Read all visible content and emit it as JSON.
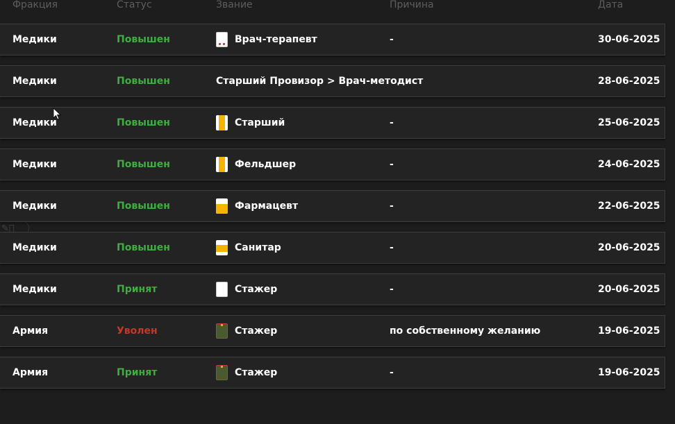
{
  "header": {
    "faction": "Фракция",
    "status": "Статус",
    "rank": "Звание",
    "reason": "Причина",
    "date": "Дата"
  },
  "rows": [
    {
      "faction": "Медики",
      "status": "Повышен",
      "status_color": "green",
      "badge": "white-red",
      "rank": "Врач-терапевт",
      "reason": "-",
      "date": "30-06-2025"
    },
    {
      "faction": "Медики",
      "status": "Повышен",
      "status_color": "green",
      "badge": "none",
      "rank": "Старший Провизор > Врач-методист",
      "reason": "",
      "date": "28-06-2025"
    },
    {
      "faction": "Медики",
      "status": "Повышен",
      "status_color": "green",
      "badge": "yellow-stripe",
      "rank": "Старший",
      "reason": "-",
      "date": "25-06-2025"
    },
    {
      "faction": "Медики",
      "status": "Повышен",
      "status_color": "green",
      "badge": "yellow-stripe",
      "rank": "Фельдшер",
      "reason": "-",
      "date": "24-06-2025"
    },
    {
      "faction": "Медики",
      "status": "Повышен",
      "status_color": "green",
      "badge": "yellow-half",
      "rank": "Фармацевт",
      "reason": "-",
      "date": "22-06-2025"
    },
    {
      "faction": "Медики",
      "status": "Повышен",
      "status_color": "green",
      "badge": "yellow-band",
      "rank": "Санитар",
      "reason": "-",
      "date": "20-06-2025"
    },
    {
      "faction": "Медики",
      "status": "Принят",
      "status_color": "green",
      "badge": "white",
      "rank": "Стажер",
      "reason": "-",
      "date": "20-06-2025"
    },
    {
      "faction": "Армия",
      "status": "Уволен",
      "status_color": "red",
      "badge": "army",
      "rank": "Стажер",
      "reason": "по собственному желанию",
      "date": "19-06-2025"
    },
    {
      "faction": "Армия",
      "status": "Принят",
      "status_color": "green",
      "badge": "army",
      "rank": "Стажер",
      "reason": "-",
      "date": "19-06-2025"
    }
  ],
  "colors": {
    "green": "#3fae3f",
    "red": "#c0392b",
    "background": "#1d1d1d",
    "row": "#232323",
    "header_text": "#5d5d5d"
  }
}
